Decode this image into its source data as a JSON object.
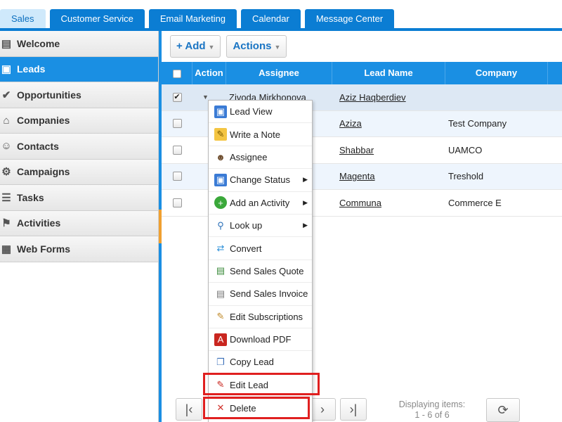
{
  "top_tabs": [
    {
      "label": "Sales",
      "active": true
    },
    {
      "label": "Customer Service",
      "active": false
    },
    {
      "label": "Email Marketing",
      "active": false
    },
    {
      "label": "Calendar",
      "active": false
    },
    {
      "label": "Message Center",
      "active": false
    }
  ],
  "sidebar": {
    "items": [
      {
        "label": "Welcome",
        "icon": "welcome-icon",
        "active": false
      },
      {
        "label": "Leads",
        "icon": "leads-icon",
        "active": true
      },
      {
        "label": "Opportunities",
        "icon": "checkmark-icon",
        "active": false
      },
      {
        "label": "Companies",
        "icon": "house-icon",
        "active": false
      },
      {
        "label": "Contacts",
        "icon": "people-icon",
        "active": false
      },
      {
        "label": "Campaigns",
        "icon": "gear-icon",
        "active": false
      },
      {
        "label": "Tasks",
        "icon": "tasks-icon",
        "active": false
      },
      {
        "label": "Activities",
        "icon": "activities-icon",
        "active": false
      },
      {
        "label": "Web Forms",
        "icon": "forms-icon",
        "active": false
      }
    ]
  },
  "toolbar": {
    "add_label": "+ Add",
    "actions_label": "Actions"
  },
  "grid": {
    "headers": [
      "Action",
      "Assignee",
      "Lead Name",
      "Company"
    ],
    "rows": [
      {
        "checked": true,
        "assignee": "Zivoda Mirkhonova",
        "lead": "Aziz Haqberdiev",
        "company": ""
      },
      {
        "checked": false,
        "assignee": "",
        "lead": "Aziza",
        "company": "Test Company"
      },
      {
        "checked": false,
        "assignee": "",
        "lead": "Shabbar",
        "company": "UAMCO"
      },
      {
        "checked": false,
        "assignee": "",
        "lead": "Magenta",
        "company": "Treshold"
      },
      {
        "checked": false,
        "assignee": "",
        "lead": "Communa",
        "company": "Commerce E"
      }
    ]
  },
  "pager": {
    "info_line1": "Displaying items:",
    "info_line2": "1 - 6 of 6"
  },
  "context_menu": {
    "items": [
      {
        "label": "Lead View",
        "icon": "lead-view-icon",
        "submenu": false
      },
      {
        "label": "Write a Note",
        "icon": "note-icon",
        "submenu": false
      },
      {
        "label": "Assignee",
        "icon": "assignee-icon",
        "submenu": false
      },
      {
        "label": "Change Status",
        "icon": "status-icon",
        "submenu": true
      },
      {
        "label": "Add an Activity",
        "icon": "add-activity-icon",
        "submenu": true
      },
      {
        "label": "Look up",
        "icon": "magnifier-icon",
        "submenu": true
      },
      {
        "label": "Convert",
        "icon": "convert-icon",
        "submenu": false
      },
      {
        "label": "Send Sales Quote",
        "icon": "quote-icon",
        "submenu": false
      },
      {
        "label": "Send Sales Invoice",
        "icon": "invoice-icon",
        "submenu": false
      },
      {
        "label": "Edit Subscriptions",
        "icon": "edit-subscriptions-icon",
        "submenu": false
      },
      {
        "label": "Download PDF",
        "icon": "pdf-icon",
        "submenu": false
      },
      {
        "label": "Copy Lead",
        "icon": "copy-icon",
        "submenu": false
      },
      {
        "label": "Edit Lead",
        "icon": "edit-lead-icon",
        "submenu": false
      },
      {
        "label": "Delete",
        "icon": "delete-icon",
        "submenu": false
      }
    ]
  },
  "colors": {
    "accent_blue": "#1a8fe3",
    "highlight_red": "#e02020"
  }
}
